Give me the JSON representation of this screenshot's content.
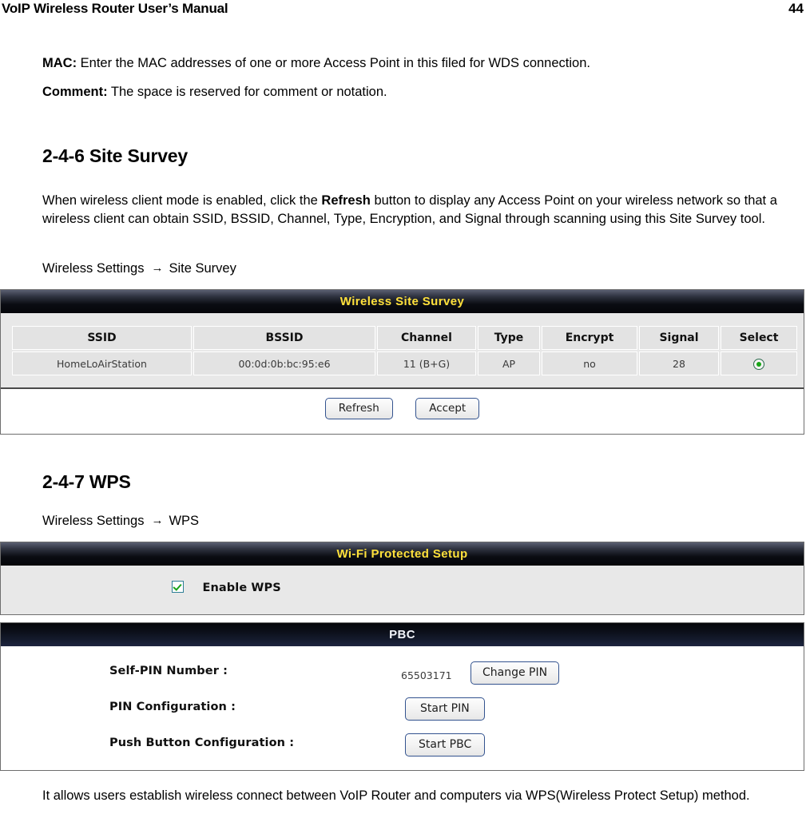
{
  "running_head": {
    "title": "VoIP Wireless Router User’s Manual",
    "page_number": "44"
  },
  "body": {
    "mac_label": "MAC:",
    "mac_text": " Enter the MAC addresses of one or more Access Point in this filed for WDS connection.",
    "comment_label": "Comment:",
    "comment_text": " The space is reserved for comment or notation.",
    "site_survey_heading": "2-4-6 Site Survey",
    "site_survey_para_1": "When wireless client mode is enabled, click the ",
    "site_survey_para_bold": "Refresh",
    "site_survey_para_2": " button to display any Access Point on your wireless network so that a wireless client can obtain SSID, BSSID, Channel, Type, Encryption, and Signal through scanning using this Site Survey tool.",
    "path_site_root": "Wireless Settings",
    "path_arrow": "→",
    "path_site_leaf": "Site Survey",
    "wps_heading": "2-4-7 WPS",
    "path_wps_root": "Wireless Settings",
    "path_wps_leaf": "WPS",
    "footer_text": "It allows users establish wireless connect between VoIP Router and computers via WPS(Wireless Protect Setup) method."
  },
  "site_survey_panel": {
    "title": "Wireless Site Survey",
    "columns": [
      "SSID",
      "BSSID",
      "Channel",
      "Type",
      "Encrypt",
      "Signal",
      "Select"
    ],
    "rows": [
      {
        "ssid": "HomeLoAirStation",
        "bssid": "00:0d:0b:bc:95:e6",
        "channel": "11 (B+G)",
        "type": "AP",
        "encrypt": "no",
        "signal": "28",
        "select": "selected-radio-icon"
      }
    ],
    "buttons": {
      "refresh": "Refresh",
      "accept": "Accept"
    }
  },
  "wps_panel": {
    "title": "Wi-Fi Protected Setup",
    "enable_wps_label": "Enable WPS",
    "enable_wps_checked": true
  },
  "pbc_panel": {
    "title": "PBC",
    "self_pin_label": "Self-PIN Number :",
    "self_pin_value": "65503171",
    "change_pin_button": "Change PIN",
    "pin_config_label": "PIN Configuration :",
    "start_pin_button": "Start PIN",
    "push_button_config_label": "Push Button Configuration :",
    "start_pbc_button": "Start PBC"
  },
  "colors": {
    "panel_title_yellow": "#ffe13b",
    "panel_title_white": "#f2f4fa",
    "panel_header_dark": "#0a0c12",
    "cell_background": "#e3e3e3",
    "body_background": "#e8e8e8",
    "button_border_blue": "#33538f",
    "checkbox_border": "#2e7f96",
    "check_green": "#19a319",
    "radio_green": "#18a518"
  }
}
